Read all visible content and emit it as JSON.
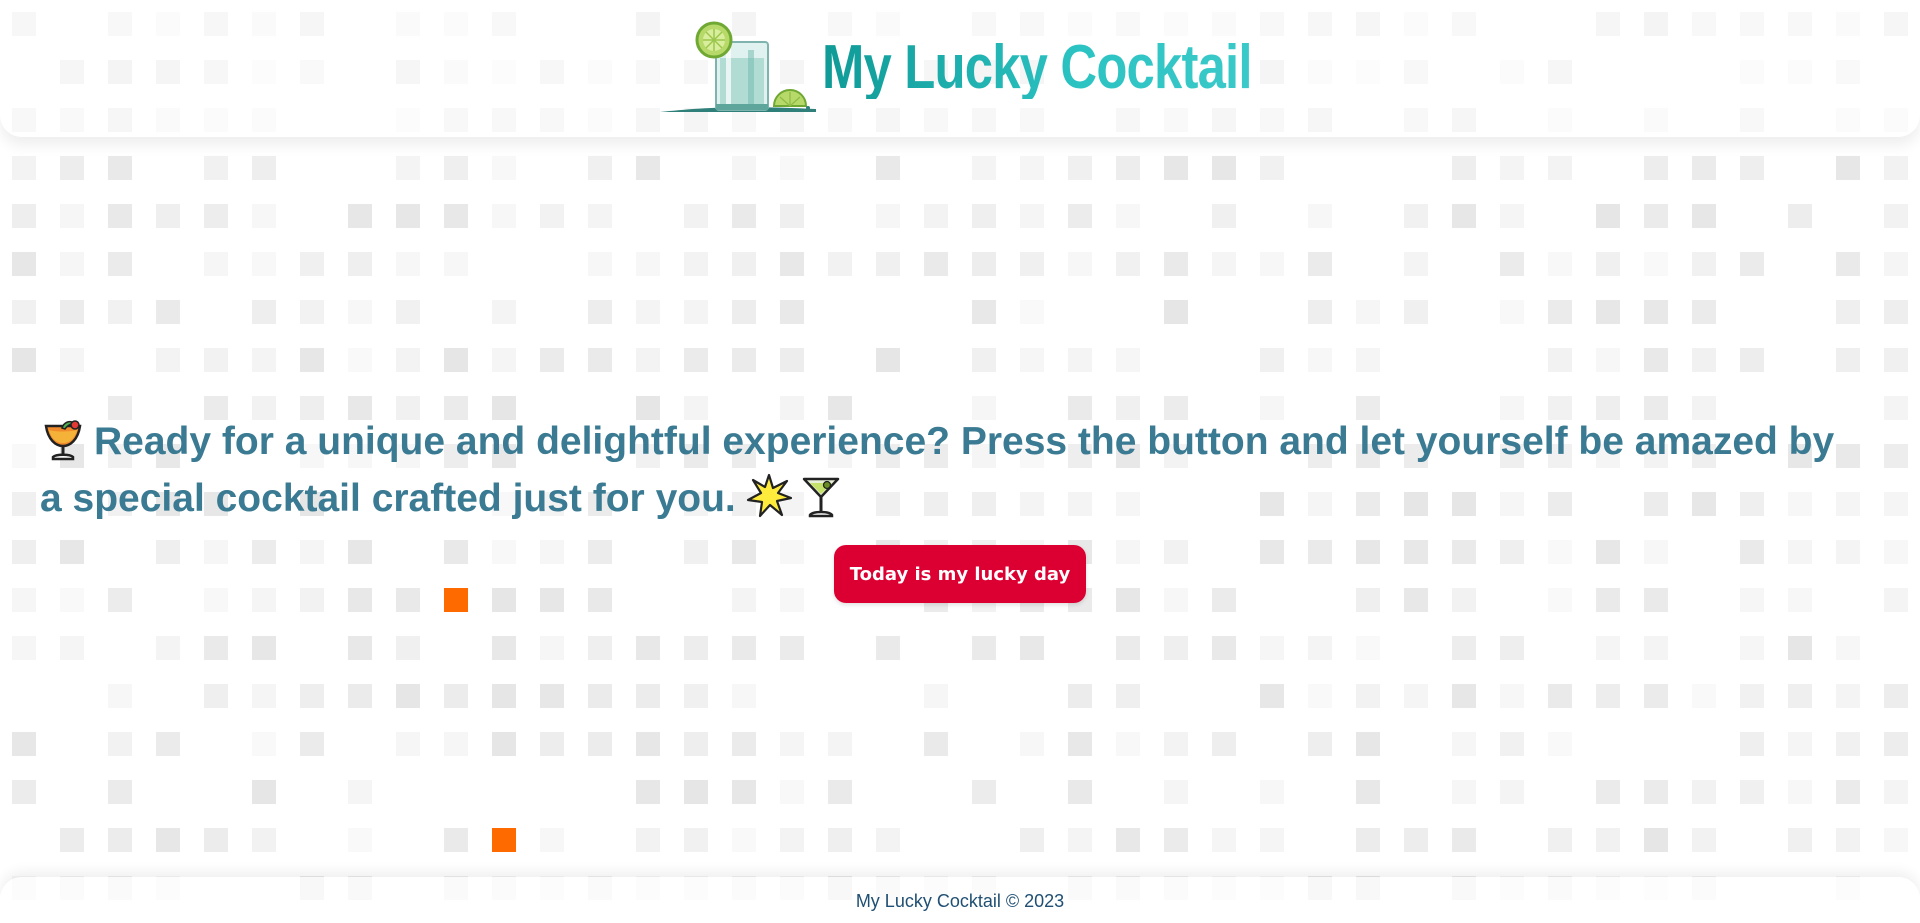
{
  "header": {
    "title": "My Lucky Cocktail",
    "logo_icon": "cocktail-glass-with-lime-icon"
  },
  "main": {
    "lead_emoji": "tropical-drink-icon",
    "message": "Ready for a unique and delightful experience? Press the button and let yourself be amazed by a special cocktail crafted just for you.",
    "trail_emojis": [
      "sparkle-star-icon",
      "cocktail-glass-icon"
    ],
    "button_label": "Today is my lucky day"
  },
  "footer": {
    "copyright": "My Lucky Cocktail © 2023"
  },
  "colors": {
    "title_gradient": [
      "#0f9a96",
      "#3bc9c9"
    ],
    "message_text": "#3a7a92",
    "button_bg": "#dc0032",
    "button_text": "#ffffff",
    "footer_text": "#1f4f73",
    "background_tile": "#e6e6e6",
    "accent_tile": "#ff6a00"
  }
}
